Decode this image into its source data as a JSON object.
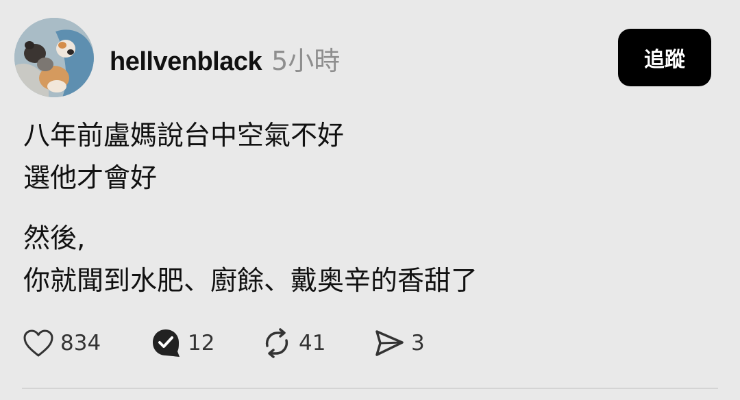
{
  "post": {
    "author": {
      "username": "hellvenblack",
      "avatar_icon": "avatar-cats-photo"
    },
    "timestamp": "5小時",
    "follow_label": "追蹤",
    "body": {
      "paragraph1": {
        "line1": "八年前盧媽說台中空氣不好",
        "line2": "選他才會好"
      },
      "paragraph2": {
        "line1": "然後,",
        "line2": "你就聞到水肥、廚餘、戴奥辛的香甜了"
      }
    },
    "actions": {
      "like": {
        "icon": "heart-icon",
        "count": "834"
      },
      "reply": {
        "icon": "reply-bubble-icon",
        "count": "12"
      },
      "repost": {
        "icon": "repost-icon",
        "count": "41"
      },
      "share": {
        "icon": "send-icon",
        "count": "3"
      }
    }
  },
  "colors": {
    "background": "#e9e9e9",
    "text": "#111111",
    "muted": "#8e8e8e",
    "button_bg": "#000000",
    "button_text": "#ffffff"
  }
}
